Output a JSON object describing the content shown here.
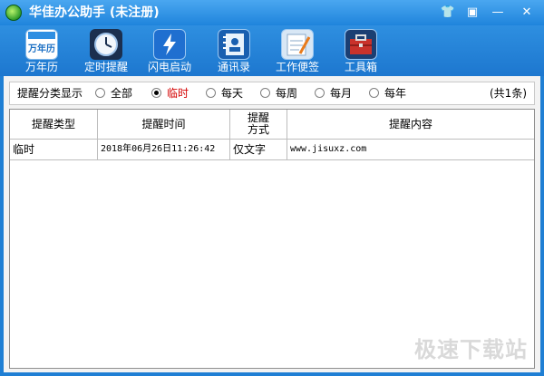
{
  "window": {
    "title": "华佳办公助手 (未注册)",
    "controls": {
      "skin": "👕",
      "menu": "▣",
      "minimize": "—",
      "close": "✕"
    }
  },
  "toolbar": {
    "items": [
      {
        "label": "万年历",
        "icon": "calendar-icon",
        "icon_text": "万年历"
      },
      {
        "label": "定时提醒",
        "icon": "clock-icon"
      },
      {
        "label": "闪电启动",
        "icon": "lightning-icon"
      },
      {
        "label": "通讯录",
        "icon": "contacts-icon"
      },
      {
        "label": "工作便签",
        "icon": "notepad-icon"
      },
      {
        "label": "工具箱",
        "icon": "toolbox-icon"
      }
    ]
  },
  "filter": {
    "label": "提醒分类显示",
    "options": [
      "全部",
      "临时",
      "每天",
      "每周",
      "每月",
      "每年"
    ],
    "selected": "临时",
    "count_text": "(共1条)"
  },
  "table": {
    "columns": [
      "提醒类型",
      "提醒时间",
      "提醒方式",
      "提醒内容"
    ],
    "rows": [
      {
        "type": "临时",
        "time": "2018年06月26日11:26:42",
        "method": "仅文字",
        "content": "www.jisuxz.com"
      }
    ]
  },
  "watermark": "极速下载站",
  "colors": {
    "accent": "#1f84dc",
    "selected_text": "#d40000"
  }
}
